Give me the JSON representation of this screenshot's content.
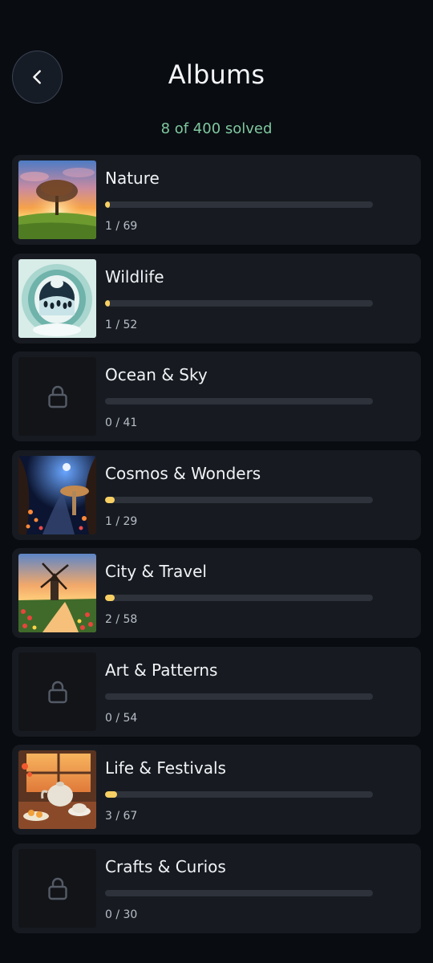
{
  "header": {
    "title": "Albums",
    "back_icon": "chevron-left-icon",
    "progress_summary": "8 of 400 solved"
  },
  "colors": {
    "background": "#090c11",
    "card": "#171b21",
    "accent_progress": "#f7cf63",
    "summary_text": "#7fc8a0",
    "bar_track": "#2d323b"
  },
  "albums": [
    {
      "name": "Nature",
      "progress_text": "1 / 69",
      "solved": 1,
      "total": 69,
      "locked": false,
      "thumbnail": "sunset-tree-thumbnail"
    },
    {
      "name": "Wildlife",
      "progress_text": "1 / 52",
      "solved": 1,
      "total": 52,
      "locked": false,
      "thumbnail": "penguins-papercut-thumbnail"
    },
    {
      "name": "Ocean & Sky",
      "progress_text": "0 / 41",
      "solved": 0,
      "total": 41,
      "locked": true,
      "thumbnail": "lock-icon"
    },
    {
      "name": "Cosmos & Wonders",
      "progress_text": "1 / 29",
      "solved": 1,
      "total": 29,
      "locked": false,
      "thumbnail": "fantasy-mushroom-thumbnail"
    },
    {
      "name": "City & Travel",
      "progress_text": "2 / 58",
      "solved": 2,
      "total": 58,
      "locked": false,
      "thumbnail": "windmill-tulips-thumbnail"
    },
    {
      "name": "Art & Patterns",
      "progress_text": "0 / 54",
      "solved": 0,
      "total": 54,
      "locked": true,
      "thumbnail": "lock-icon"
    },
    {
      "name": "Life & Festivals",
      "progress_text": "3 / 67",
      "solved": 3,
      "total": 67,
      "locked": false,
      "thumbnail": "teapot-table-thumbnail"
    },
    {
      "name": "Crafts & Curios",
      "progress_text": "0 / 30",
      "solved": 0,
      "total": 30,
      "locked": true,
      "thumbnail": "lock-icon"
    }
  ]
}
